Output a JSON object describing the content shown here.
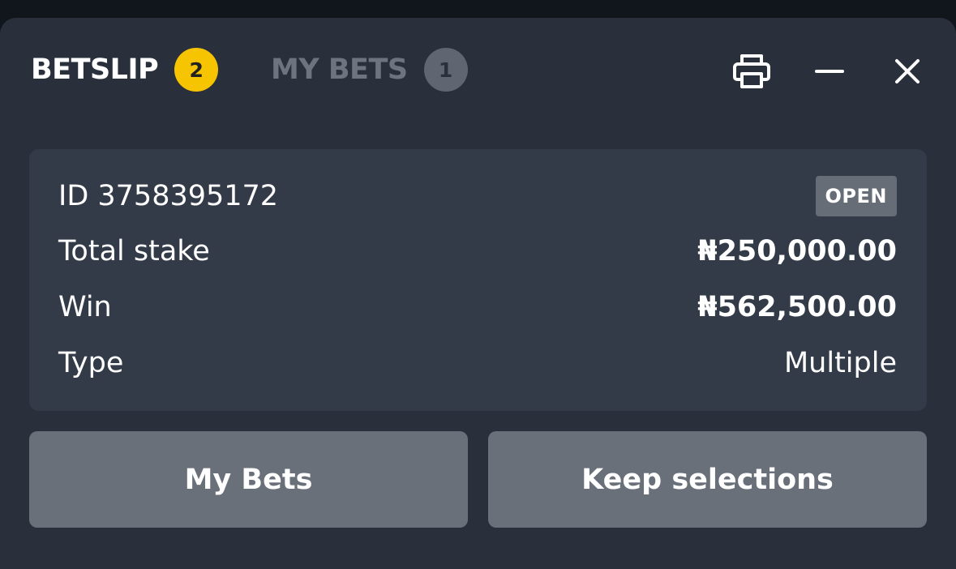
{
  "header": {
    "tabs": [
      {
        "label": "BETSLIP",
        "count": "2",
        "active": true
      },
      {
        "label": "MY BETS",
        "count": "1",
        "active": false
      }
    ],
    "icons": [
      "print-icon",
      "minimize-icon",
      "close-icon"
    ]
  },
  "bet": {
    "id_text": "ID 3758395172",
    "status": "OPEN",
    "rows": [
      {
        "label": "Total stake",
        "value": "₦250,000.00"
      },
      {
        "label": "Win",
        "value": "₦562,500.00"
      },
      {
        "label": "Type",
        "value": "Multiple"
      }
    ]
  },
  "actions": {
    "my_bets_label": "My Bets",
    "keep_selections_label": "Keep selections"
  },
  "colors": {
    "background": "#2a303b",
    "card": "#343b48",
    "badge_active": "#f6c400",
    "badge_inactive": "#5f6672",
    "button": "#6a7079",
    "status_badge": "#676d76"
  }
}
